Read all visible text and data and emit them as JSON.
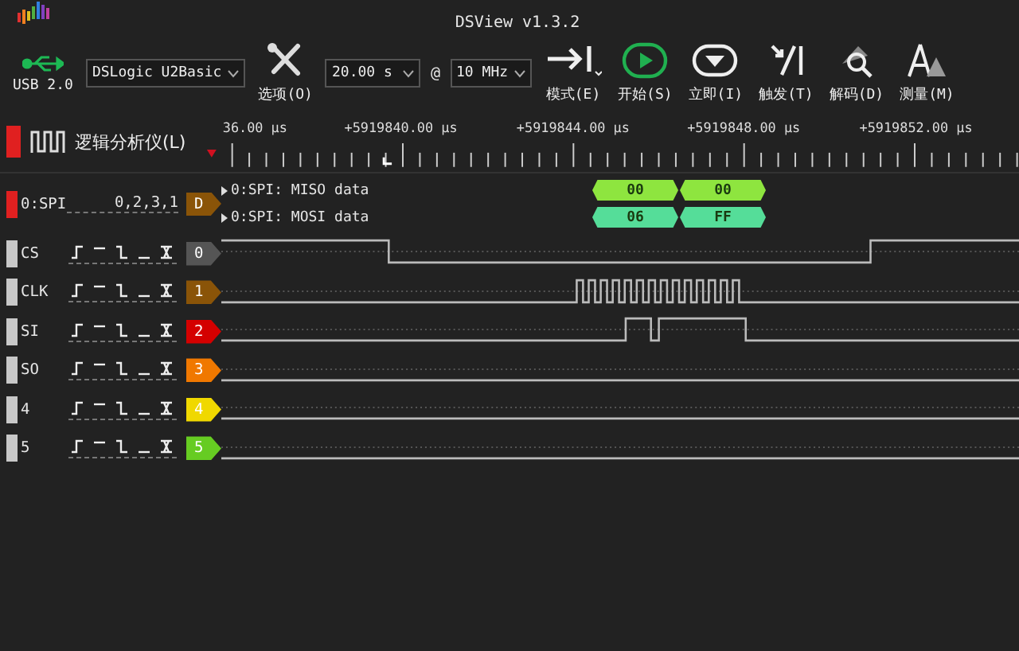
{
  "window": {
    "title": "DSView v1.3.2"
  },
  "toolbar": {
    "connection": "USB 2.0",
    "device": "DSLogic U2Basic",
    "options": "选项(O)",
    "duration": "20.00 s",
    "at": "@",
    "rate": "10 MHz",
    "buttons": [
      {
        "label": "模式(E)",
        "kind": "mode"
      },
      {
        "label": "开始(S)",
        "kind": "start"
      },
      {
        "label": "立即(I)",
        "kind": "instant"
      },
      {
        "label": "触发(T)",
        "kind": "trigger"
      },
      {
        "label": "解码(D)",
        "kind": "decode"
      },
      {
        "label": "测量(M)",
        "kind": "measure"
      }
    ]
  },
  "mode_tab": {
    "label": "逻辑分析仪(L)"
  },
  "ruler": {
    "labels": [
      "36.00 μs",
      "+5919840.00 μs",
      "+5919844.00 μs",
      "+5919848.00 μs",
      "+5919852.00 μs"
    ]
  },
  "decoder": {
    "name": "0:SPI",
    "channels": "0,2,3,1",
    "tag": "D",
    "color": "#8a5408",
    "rows": [
      {
        "label": "0:SPI: MISO data",
        "color": "#8ee53f",
        "cells": [
          "00",
          "00"
        ]
      },
      {
        "label": "0:SPI: MOSI data",
        "color": "#55dd99",
        "cells": [
          "06",
          "FF"
        ]
      }
    ]
  },
  "channels": [
    {
      "name": "CS",
      "tag": "0",
      "color": "#555555",
      "kind": "select"
    },
    {
      "name": "CLK",
      "tag": "1",
      "color": "#8a5408",
      "kind": "clock"
    },
    {
      "name": "SI",
      "tag": "2",
      "color": "#d40000",
      "kind": "data"
    },
    {
      "name": "SO",
      "tag": "3",
      "color": "#f07800",
      "kind": "idle"
    },
    {
      "name": "4",
      "tag": "4",
      "color": "#f0d800",
      "kind": "idle"
    },
    {
      "name": "5",
      "tag": "5",
      "color": "#66cc22",
      "kind": "idle"
    }
  ]
}
